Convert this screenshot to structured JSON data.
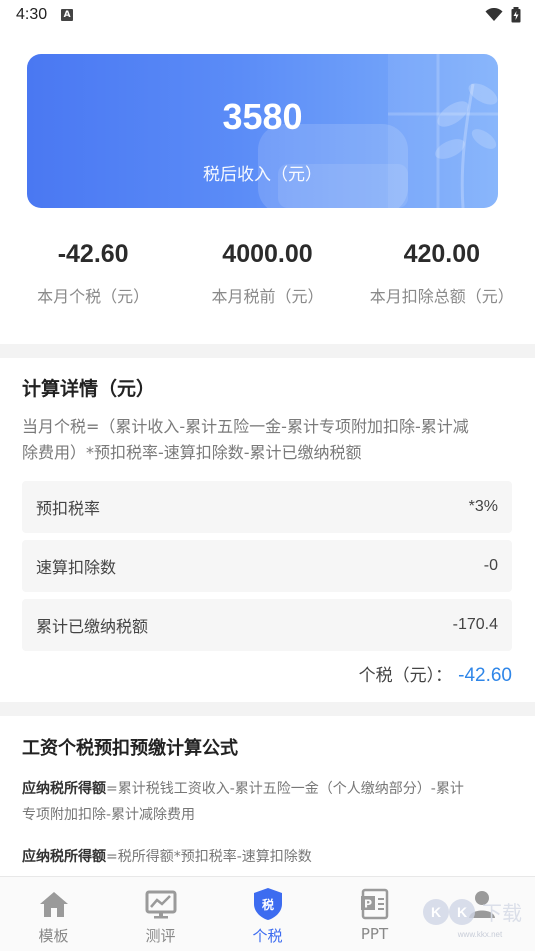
{
  "status_bar": {
    "time": "4:30",
    "notif_glyph": "A",
    "icons": [
      "a-notification-icon",
      "wifi-icon",
      "battery-icon"
    ]
  },
  "hero": {
    "amount": "3580",
    "label": "税后收入（元）",
    "gradient_colors": [
      "#4a78f2",
      "#7fb0fb"
    ]
  },
  "stats": [
    {
      "value": "-42.60",
      "label": "本月个税（元）"
    },
    {
      "value": "4000.00",
      "label": "本月税前（元）"
    },
    {
      "value": "420.00",
      "label": "本月扣除总额（元）"
    }
  ],
  "detail": {
    "title": "计算详情（元）",
    "formula_line1": "当月个税=（累计收入-累计五险一金-累计专项附加扣除-累计减",
    "formula_line2": "除费用）*预扣税率-速算扣除数-累计已缴纳税额",
    "rows": [
      {
        "label": "预扣税率",
        "value": "*3%"
      },
      {
        "label": "速算扣除数",
        "value": "-0"
      },
      {
        "label": "累计已缴纳税额",
        "value": "-170.4"
      }
    ],
    "total_label": "个税（元）：",
    "total_value": "-42.60",
    "accent_color": "#2f86e8"
  },
  "formulas": {
    "title": "工资个税预扣预缴计算公式",
    "items": [
      {
        "term": "应纳税所得额",
        "line1": "=累计税钱工资收入-累计五险一金（个人缴纳部分）-累计",
        "line2": "专项附加扣除-累计减除费用"
      },
      {
        "term": "应纳税所得额",
        "line1": "=税所得额*预扣税率-速算扣除数",
        "line2": ""
      }
    ]
  },
  "tabbar": {
    "tabs": [
      {
        "label": "模板",
        "icon": "home-icon"
      },
      {
        "label": "测评",
        "icon": "chart-icon"
      },
      {
        "label": "个税",
        "icon": "tax-shield-icon",
        "badge": "税"
      },
      {
        "label": "PPT",
        "icon": "ppt-icon",
        "badge": "P"
      },
      {
        "label": "",
        "icon": "profile-icon"
      }
    ],
    "active_color": "#3d6cf0"
  },
  "watermark": {
    "text": "KK下载",
    "url": "www.kkx.net"
  }
}
